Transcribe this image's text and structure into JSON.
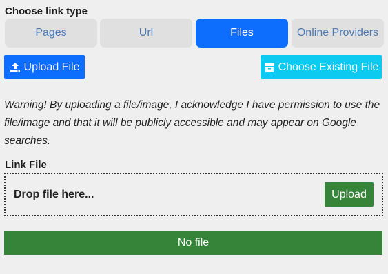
{
  "section_title": "Choose link type",
  "tabs": [
    {
      "label": "Pages"
    },
    {
      "label": "Url"
    },
    {
      "label": "Files",
      "active": true
    },
    {
      "label": "Online Providers"
    }
  ],
  "actions": {
    "upload_file": "Upload File",
    "choose_existing": "Choose Existing File"
  },
  "warning": "Warning! By uploading a file/image, I acknowledge I have permission to use the file/image and that it will be publicly accessible and may appear on Google searches.",
  "link_file": {
    "label": "Link File",
    "drop_text": "Drop file here...",
    "upload_button": "Upload"
  },
  "status": "No file",
  "colors": {
    "primary": "#0d6efd",
    "info": "#0dcaf0",
    "success": "#35843a",
    "tab_inactive_bg": "#e0e0e0",
    "tab_inactive_text": "#4a7bb6"
  },
  "icons": {
    "upload": "upload-icon",
    "archive": "archive-box-icon"
  }
}
